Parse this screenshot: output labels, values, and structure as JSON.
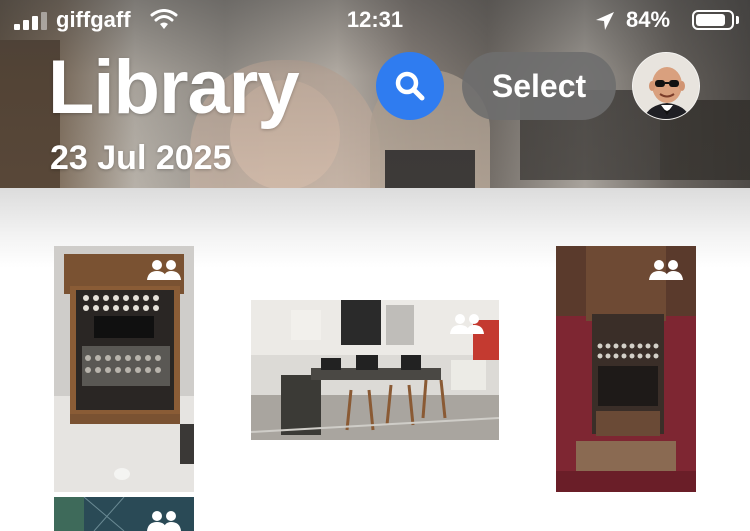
{
  "status_bar": {
    "carrier": "giffgaff",
    "time": "12:31",
    "battery_percent": "84%",
    "battery_level": 0.84
  },
  "header": {
    "title": "Library",
    "date": "23 Jul 2025",
    "select_label": "Select"
  },
  "photos": [
    {
      "subject": "enigma-machine-wooden-box",
      "shared": true
    },
    {
      "subject": "museum-room-with-machines",
      "shared": true
    },
    {
      "subject": "enigma-machine-red-display",
      "shared": true
    },
    {
      "subject": "museum-dark-room",
      "shared": true
    }
  ],
  "icons": {
    "search": "magnifier-icon",
    "shared": "shared-people-icon",
    "location": "location-arrow-icon"
  },
  "colors": {
    "accent": "#2f7cf0",
    "select_bg": "#6e6e6e"
  }
}
